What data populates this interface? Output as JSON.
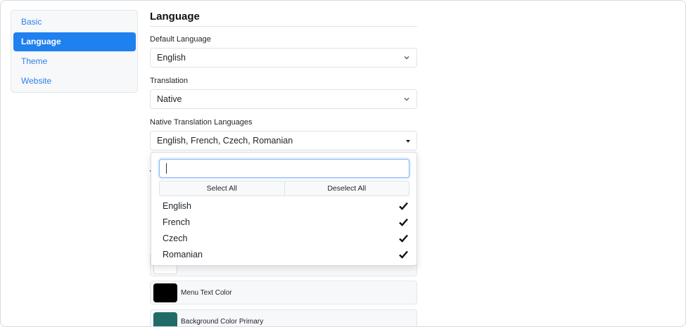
{
  "sidebar": {
    "items": [
      {
        "label": "Basic",
        "active": false
      },
      {
        "label": "Language",
        "active": true
      },
      {
        "label": "Theme",
        "active": false
      },
      {
        "label": "Website",
        "active": false
      }
    ]
  },
  "section": {
    "title": "Language"
  },
  "fields": {
    "default_language": {
      "label": "Default Language",
      "value": "English"
    },
    "translation": {
      "label": "Translation",
      "value": "Native"
    },
    "native_languages": {
      "label": "Native Translation Languages",
      "value": "English, French, Czech, Romanian"
    }
  },
  "dropdown": {
    "search_value": "",
    "select_all": "Select All",
    "deselect_all": "Deselect All",
    "options": [
      {
        "label": "English",
        "selected": true
      },
      {
        "label": "French",
        "selected": true
      },
      {
        "label": "Czech",
        "selected": true
      },
      {
        "label": "Romanian",
        "selected": true
      }
    ]
  },
  "colors": [
    {
      "label": "",
      "swatch": "#ffffff"
    },
    {
      "label": "Menu Text Color",
      "swatch": "#000000"
    },
    {
      "label": "Background Color Primary",
      "swatch": "#1f6b68"
    }
  ],
  "theme": {
    "accent": "#1f80f0",
    "link": "#2f80ed"
  },
  "icons": {
    "select_chevron": "chevron-down-icon",
    "multiselect_caret": "caret-down-icon",
    "option_check": "check-icon"
  }
}
